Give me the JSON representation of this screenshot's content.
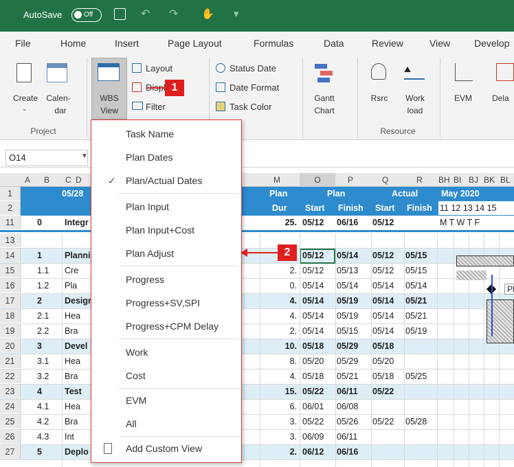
{
  "titlebar": {
    "autosave_label": "AutoSave",
    "toggle_state": "Off"
  },
  "menu_tabs": [
    "File",
    "Home",
    "Insert",
    "Page Layout",
    "Formulas",
    "Data",
    "Review",
    "View",
    "Develop"
  ],
  "ribbon": {
    "create": "Create",
    "calendar_1": "Calen-",
    "calendar_2": "dar",
    "group_project": "Project",
    "wbs_1": "WBS",
    "wbs_2": "View",
    "layout": "Layout",
    "display": "Display",
    "filter": "Filter",
    "status_date": "Status Date",
    "date_format": "Date Format",
    "task_color": "Task Color",
    "gantt_1": "Gantt",
    "gantt_2": "Chart",
    "rsrc": "Rsrc",
    "work_1": "Work",
    "work_2": "load",
    "group_resource": "Resource",
    "evm": "EVM",
    "dela": "Dela"
  },
  "namebox": {
    "value": "O14"
  },
  "columns": [
    "A",
    "B",
    "C",
    "D",
    "M",
    "O",
    "P",
    "Q",
    "R",
    "BH",
    "BI",
    "BJ",
    "BK",
    "BL"
  ],
  "header_rows": {
    "r1": {
      "date": "05/28",
      "plan_dur": "Plan",
      "plan": "Plan",
      "actual": "Actual",
      "month": "May 2020"
    },
    "r2": {
      "dur": "Dur",
      "start": "Start",
      "finish": "Finish",
      "astart": "Start",
      "afinish": "Finish",
      "days": "11 12 13 14 15"
    },
    "r11": {
      "wbs": "0",
      "name": "Integr",
      "dur": "25.",
      "start": "05/12",
      "finish": "06/16",
      "astart": "05/12",
      "weekdays": "M  T  W  T  F"
    }
  },
  "rows": [
    {
      "num": "13",
      "wbs": "",
      "name": "",
      "dur": "",
      "start": "",
      "finish": "",
      "astart": "",
      "afinish": "",
      "bold": false
    },
    {
      "num": "14",
      "wbs": "1",
      "name": "Planni",
      "dur": "",
      "start": "05/12",
      "finish": "05/14",
      "astart": "05/12",
      "afinish": "05/15",
      "bold": true
    },
    {
      "num": "15",
      "wbs": "1.1",
      "name": "Cre",
      "dur": "2.",
      "start": "05/12",
      "finish": "05/13",
      "astart": "05/12",
      "afinish": "05/15",
      "bold": false
    },
    {
      "num": "16",
      "wbs": "1.2",
      "name": "Pla",
      "dur": "0.",
      "start": "05/14",
      "finish": "05/14",
      "astart": "05/14",
      "afinish": "05/14",
      "bold": false
    },
    {
      "num": "17",
      "wbs": "2",
      "name": "Desigr",
      "dur": "4.",
      "start": "05/14",
      "finish": "05/19",
      "astart": "05/14",
      "afinish": "05/21",
      "bold": true
    },
    {
      "num": "18",
      "wbs": "2.1",
      "name": "Hea",
      "dur": "4.",
      "start": "05/14",
      "finish": "05/19",
      "astart": "05/14",
      "afinish": "05/21",
      "bold": false
    },
    {
      "num": "19",
      "wbs": "2.2",
      "name": "Bra",
      "dur": "2.",
      "start": "05/14",
      "finish": "05/15",
      "astart": "05/14",
      "afinish": "05/19",
      "bold": false
    },
    {
      "num": "20",
      "wbs": "3",
      "name": "Devel",
      "dur": "10.",
      "start": "05/18",
      "finish": "05/29",
      "astart": "05/18",
      "afinish": "",
      "bold": true
    },
    {
      "num": "21",
      "wbs": "3.1",
      "name": "Hea",
      "dur": "8.",
      "start": "05/20",
      "finish": "05/29",
      "astart": "05/20",
      "afinish": "",
      "bold": false
    },
    {
      "num": "22",
      "wbs": "3.2",
      "name": "Bra",
      "dur": "4.",
      "start": "05/18",
      "finish": "05/21",
      "astart": "05/18",
      "afinish": "05/25",
      "bold": false
    },
    {
      "num": "23",
      "wbs": "4",
      "name": "Test",
      "dur": "15.",
      "start": "05/22",
      "finish": "06/11",
      "astart": "05/22",
      "afinish": "",
      "bold": true
    },
    {
      "num": "24",
      "wbs": "4.1",
      "name": "Hea",
      "dur": "6.",
      "start": "06/01",
      "finish": "06/08",
      "astart": "",
      "afinish": "",
      "bold": false
    },
    {
      "num": "25",
      "wbs": "4.2",
      "name": "Bra",
      "dur": "3.",
      "start": "05/22",
      "finish": "05/26",
      "astart": "05/22",
      "afinish": "05/28",
      "bold": false
    },
    {
      "num": "26",
      "wbs": "4.3",
      "name": "Int",
      "dur": "3.",
      "start": "06/09",
      "finish": "06/11",
      "astart": "",
      "afinish": "",
      "bold": false
    },
    {
      "num": "27",
      "wbs": "5",
      "name": "Deplo",
      "dur": "2.",
      "start": "06/12",
      "finish": "06/16",
      "astart": "",
      "afinish": "",
      "bold": true
    }
  ],
  "menu": {
    "task_name": "Task Name",
    "plan_dates": "Plan Dates",
    "plan_actual": "Plan/Actual Dates",
    "check": "✓",
    "plan_input": "Plan Input",
    "plan_input_cost": "Plan Input+Cost",
    "plan_adjust": "Plan Adjust",
    "progress": "Progress",
    "progress_sv": "Progress+SV,SPI",
    "progress_cpm": "Progress+CPM Delay",
    "work": "Work",
    "cost": "Cost",
    "evm": "EVM",
    "all": "All",
    "add_custom": "Add Custom View"
  },
  "callouts": {
    "one": "1",
    "two": "2"
  },
  "gantt_label": "Pl",
  "colors": {
    "excel_green": "#217346",
    "header_blue": "#2e8bce",
    "callout_red": "#e01e1e",
    "summary_fill": "#deeef6"
  }
}
